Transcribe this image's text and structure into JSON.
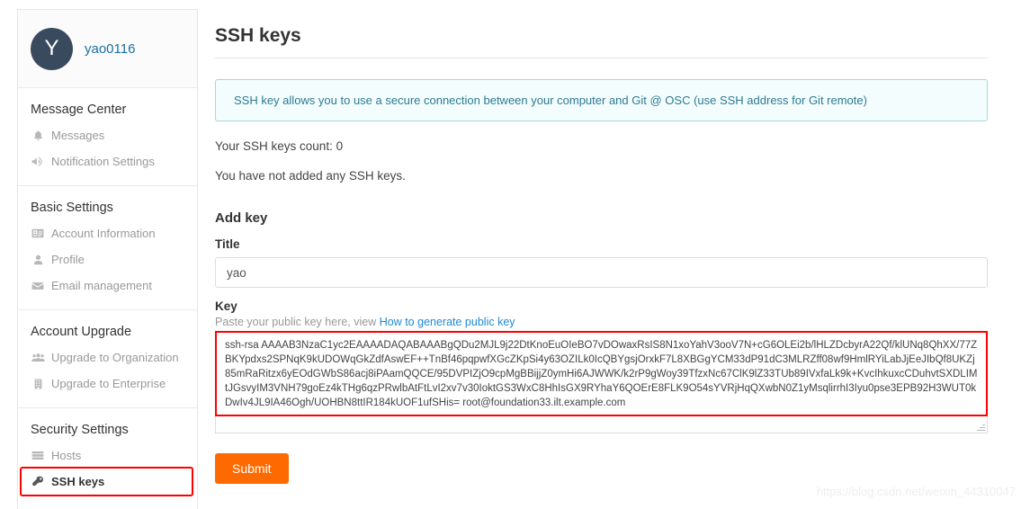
{
  "sidebar": {
    "profile": {
      "avatar_letter": "Y",
      "username": "yao0116"
    },
    "groups": [
      {
        "title": "Message Center",
        "items": [
          {
            "label": "Messages",
            "icon": "bell-icon",
            "glyph": "⬤",
            "active": false
          },
          {
            "label": "Notification Settings",
            "icon": "megaphone-icon",
            "glyph": "◀",
            "active": false
          }
        ]
      },
      {
        "title": "Basic Settings",
        "items": [
          {
            "label": "Account Information",
            "icon": "id-card-icon",
            "glyph": "▤",
            "active": false
          },
          {
            "label": "Profile",
            "icon": "user-icon",
            "glyph": "●",
            "active": false
          },
          {
            "label": "Email management",
            "icon": "envelope-icon",
            "glyph": "✉",
            "active": false
          }
        ]
      },
      {
        "title": "Account Upgrade",
        "items": [
          {
            "label": "Upgrade to Organization",
            "icon": "users-group-icon",
            "glyph": "●",
            "active": false
          },
          {
            "label": "Upgrade to Enterprise",
            "icon": "building-icon",
            "glyph": "▦",
            "active": false
          }
        ]
      },
      {
        "title": "Security Settings",
        "items": [
          {
            "label": "Hosts",
            "icon": "server-icon",
            "glyph": "≡",
            "active": false
          },
          {
            "label": "SSH keys",
            "icon": "key-icon",
            "glyph": "⚿",
            "active": true,
            "highlighted": true
          }
        ]
      }
    ]
  },
  "main": {
    "page_title": "SSH keys",
    "alert_text": "SSH key allows you to use a secure connection between your computer and Git @ OSC (use SSH address for Git remote)",
    "keys_count_text": "Your SSH keys count: 0",
    "empty_text": "You have not added any SSH keys.",
    "add_key_heading": "Add key",
    "title_label": "Title",
    "title_value": "yao",
    "title_placeholder": "",
    "key_label": "Key",
    "key_helper_prefix": "Paste your public key here, view ",
    "key_helper_link": "How to generate public key",
    "key_value": "ssh-rsa AAAAB3NzaC1yc2EAAAADAQABAAABgQDu2MJL9j22DtKnoEuOIeBO7vDOwaxRsIS8N1xoYahV3ooV7N+cG6OLEi2b/lHLZDcbyrA22Qf/klUNq8QhXX/77ZBKYpdxs2SPNqK9kUDOWqGkZdfAswEF++TnBf46pqpwfXGcZKpSi4y63OZILk0IcQBYgsjOrxkF7L8XBGgYCM33dP91dC3MLRZff08wf9HmlRYiLabJjEeJIbQf8UKZj85mRaRitzx6yEOdGWbS86acj8iPAamQQCE/95DVPIZjO9cpMgBBijjZ0ymHi6AJWWK/k2rP9gWoy39TfzxNc67ClK9lZ33TUb89IVxfaLk9k+KvcIhkuxcCDuhvtSXDLIMtJGsvyIM3VNH79goEz4kTHg6qzPRwlbAtFtLvI2xv7v30IoktGS3WxC8HhIsGX9RYhaY6QOErE8FLK9O54sYVRjHqQXwbN0Z1yMsqlirrhI3Iyu0pse3EPB92H3WUT0kDwIv4JL9IA46Ogh/UOHBN8ttIR184kUOF1ufSHis= root@foundation33.ilt.example.com",
    "submit_label": "Submit"
  },
  "watermark": "https://blog.csdn.net/weixin_44310047",
  "colors": {
    "accent_orange": "#ff6a00",
    "link_blue": "#1e8ad6",
    "alert_border": "#a8d8d8",
    "alert_bg": "#f4fdfd",
    "highlight_red": "#ff0000",
    "avatar_bg": "#3a4a5e"
  }
}
